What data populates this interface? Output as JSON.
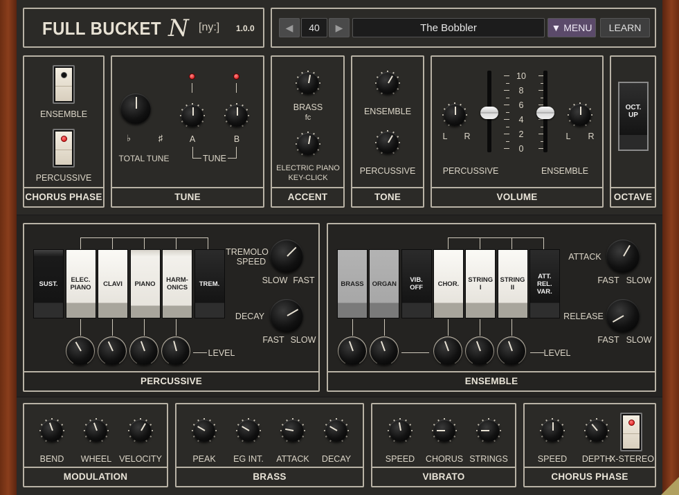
{
  "header": {
    "brand": "FULL BUCKET",
    "logo_letter": "N",
    "subtitle": "[ny:]",
    "version": "1.0.0",
    "preset_number": "40",
    "preset_name": "The Bobbler",
    "menu_label": "▼ MENU",
    "learn_label": "LEARN",
    "prev_icon": "◀",
    "next_icon": "▶"
  },
  "chorus_phase_top": {
    "ensemble_label": "ENSEMBLE",
    "percussive_label": "PERCUSSIVE",
    "title": "CHORUS PHASE",
    "ensemble_on": false,
    "percussive_on": true
  },
  "tune": {
    "total_label": "TOTAL TUNE",
    "flat": "♭",
    "sharp": "♯",
    "a_label": "A",
    "b_label": "B",
    "tune_label": "TUNE",
    "title": "TUNE"
  },
  "accent": {
    "brass_label": "BRASS",
    "fc_label": "fc",
    "epiano_label_1": "ELECTRIC PIANO",
    "epiano_label_2": "KEY-CLICK",
    "title": "ACCENT"
  },
  "tone": {
    "ensemble_label": "ENSEMBLE",
    "percussive_label": "PERCUSSIVE",
    "title": "TONE"
  },
  "volume": {
    "l": "L",
    "r": "R",
    "scale": [
      "10",
      "8",
      "6",
      "4",
      "2",
      "0"
    ],
    "percussive_label": "PERCUSSIVE",
    "ensemble_label": "ENSEMBLE",
    "title": "VOLUME"
  },
  "octave": {
    "button_line1": "OCT.",
    "button_line2": "UP",
    "title": "OCTAVE"
  },
  "percussive": {
    "tabs": [
      {
        "line1": "SUST.",
        "line2": ""
      },
      {
        "line1": "ELEC.",
        "line2": "PIANO"
      },
      {
        "line1": "CLAVI",
        "line2": ""
      },
      {
        "line1": "PIANO",
        "line2": ""
      },
      {
        "line1": "HARM-",
        "line2": "ONICS"
      },
      {
        "line1": "TREM.",
        "line2": ""
      }
    ],
    "tremolo_label_1": "TREMOLO",
    "tremolo_label_2": "SPEED",
    "slow": "SLOW",
    "fast": "FAST",
    "decay_label": "DECAY",
    "level_label": "LEVEL",
    "title": "PERCUSSIVE"
  },
  "ensemble": {
    "tabs": [
      {
        "line1": "BRASS",
        "line2": "",
        "line3": ""
      },
      {
        "line1": "ORGAN",
        "line2": "",
        "line3": ""
      },
      {
        "line1": "VIB.",
        "line2": "OFF",
        "line3": ""
      },
      {
        "line1": "CHOR.",
        "line2": "",
        "line3": ""
      },
      {
        "line1": "STRING",
        "line2": "I",
        "line3": ""
      },
      {
        "line1": "STRING",
        "line2": "II",
        "line3": ""
      },
      {
        "line1": "ATT.",
        "line2": "REL.",
        "line3": "VAR."
      }
    ],
    "attack_label": "ATTACK",
    "release_label": "RELEASE",
    "fast": "FAST",
    "slow": "SLOW",
    "level_label": "LEVEL",
    "title": "ENSEMBLE"
  },
  "modulation": {
    "bend": "BEND",
    "wheel": "WHEEL",
    "velocity": "VELOCITY",
    "title": "MODULATION"
  },
  "brass": {
    "peak": "PEAK",
    "eg_int": "EG INT.",
    "attack": "ATTACK",
    "decay": "DECAY",
    "title": "BRASS"
  },
  "vibrato": {
    "speed": "SPEED",
    "chorus": "CHORUS",
    "strings": "STRINGS",
    "title": "VIBRATO"
  },
  "chorus_phase_bottom": {
    "speed": "SPEED",
    "depth": "DEPTH",
    "xstereo": "X-STEREO",
    "title": "CHORUS PHASE",
    "xstereo_on": true
  }
}
